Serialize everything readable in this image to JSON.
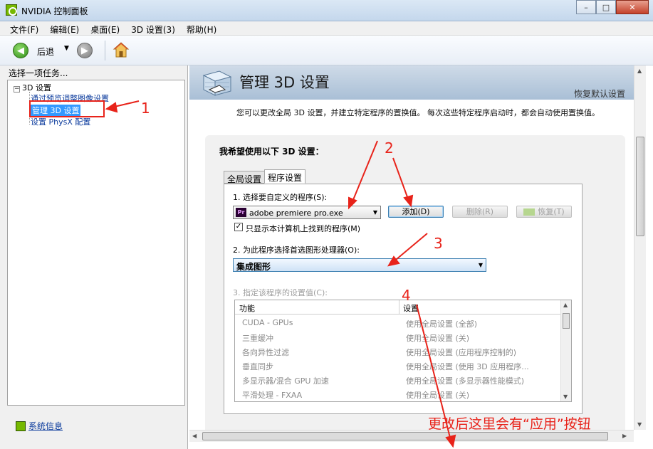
{
  "window": {
    "title": "NVIDIA 控制面板",
    "min": "–",
    "max": "□",
    "close": "✕"
  },
  "menu": [
    "文件(F)",
    "编辑(E)",
    "桌面(E)",
    "3D 设置(3)",
    "帮助(H)"
  ],
  "toolbar": {
    "back_label": "后退"
  },
  "left": {
    "header": "选择一项任务...",
    "root": "3D 设置",
    "items": [
      "通过预览调整图像设置",
      "管理 3D 设置",
      "设置 PhysX 配置"
    ],
    "sysinfo": "系统信息"
  },
  "page": {
    "title": "管理 3D 设置",
    "restore_defaults": "恢复默认设置",
    "description": "您可以更改全局 3D 设置，并建立特定程序的置换值。 每次这些特定程序启动时，都会自动使用置换值。",
    "group_title": "我希望使用以下 3D 设置：",
    "tabs": [
      "全局设置",
      "程序设置"
    ],
    "step1_label": "1. 选择要自定义的程序(S):",
    "program_selected": "adobe premiere pro.exe",
    "add_btn": "添加(D)",
    "remove_btn": "删除(R)",
    "restore_btn": "恢复(T)",
    "only_show_label": "只显示本计算机上找到的程序(M)",
    "only_show_checked": true,
    "step2_label": "2. 为此程序选择首选图形处理器(O):",
    "gpu_selected": "集成图形",
    "step3_label": "3. 指定该程序的设置值(C):",
    "table": {
      "col1": "功能",
      "col2": "设置",
      "rows": [
        [
          "CUDA - GPUs",
          "使用全局设置 (全部)"
        ],
        [
          "三重缓冲",
          "使用全局设置 (关)"
        ],
        [
          "各向异性过滤",
          "使用全局设置 (应用程序控制的)"
        ],
        [
          "垂直同步",
          "使用全局设置 (使用 3D 应用程序..."
        ],
        [
          "多显示器/混合 GPU 加速",
          "使用全局设置 (多显示器性能模式)"
        ],
        [
          "平滑处理 - FXAA",
          "使用全局设置 (关)"
        ]
      ]
    }
  },
  "annotations": {
    "n1": "1",
    "n2": "2",
    "n3": "3",
    "n4": "4",
    "note": "更改后这里会有“应用”按钮",
    "color": "#e8231a"
  }
}
